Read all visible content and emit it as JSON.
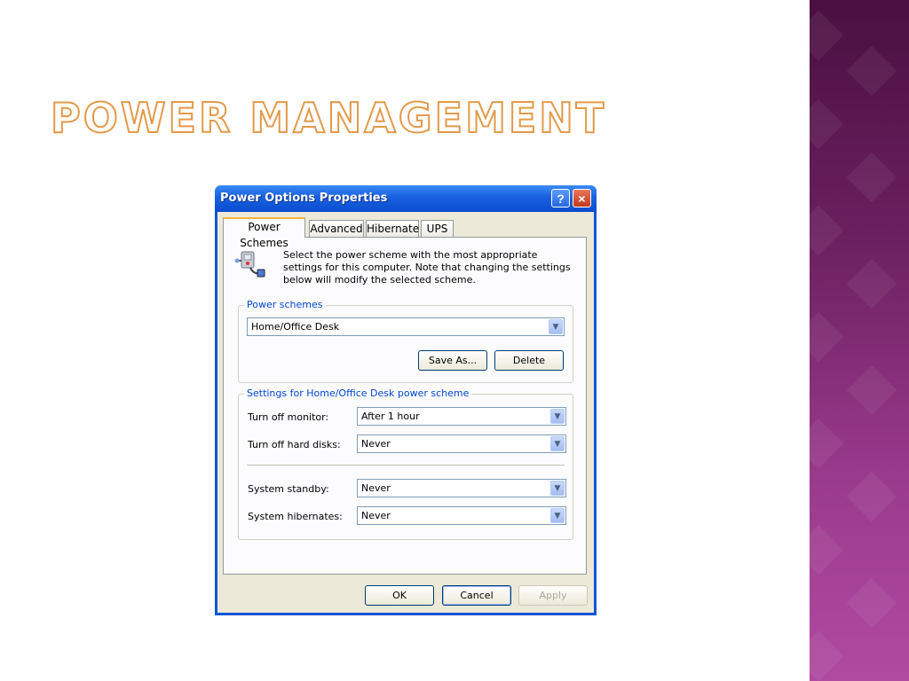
{
  "slide": {
    "title": "Power Management"
  },
  "dialog": {
    "title": "Power Options Properties",
    "help_symbol": "?",
    "close_symbol": "×",
    "tabs": [
      {
        "label": "Power Schemes",
        "active": true
      },
      {
        "label": "Advanced",
        "active": false
      },
      {
        "label": "Hibernate",
        "active": false
      },
      {
        "label": "UPS",
        "active": false
      }
    ],
    "intro_text": "Select the power scheme with the most appropriate settings for this computer. Note that changing the settings below will modify the selected scheme.",
    "power_schemes": {
      "group_label": "Power schemes",
      "selected": "Home/Office Desk",
      "save_as_label": "Save As...",
      "delete_label": "Delete"
    },
    "settings": {
      "group_label": "Settings for Home/Office Desk power scheme",
      "rows": [
        {
          "label": "Turn off monitor:",
          "value": "After 1 hour"
        },
        {
          "label": "Turn off hard disks:",
          "value": "Never"
        },
        {
          "label": "System standby:",
          "value": "Never"
        },
        {
          "label": "System hibernates:",
          "value": "Never"
        }
      ]
    },
    "buttons": {
      "ok": "OK",
      "cancel": "Cancel",
      "apply": "Apply"
    }
  },
  "icons": {
    "combo_arrow": "chevron-down-icon",
    "scheme_icon": "power-plug-computer-icon"
  },
  "colors": {
    "title_outline": "#e39a4a",
    "side_band": "#6b2060",
    "xp_titlebar": "#0a4cd0",
    "group_label": "#0046d5"
  }
}
